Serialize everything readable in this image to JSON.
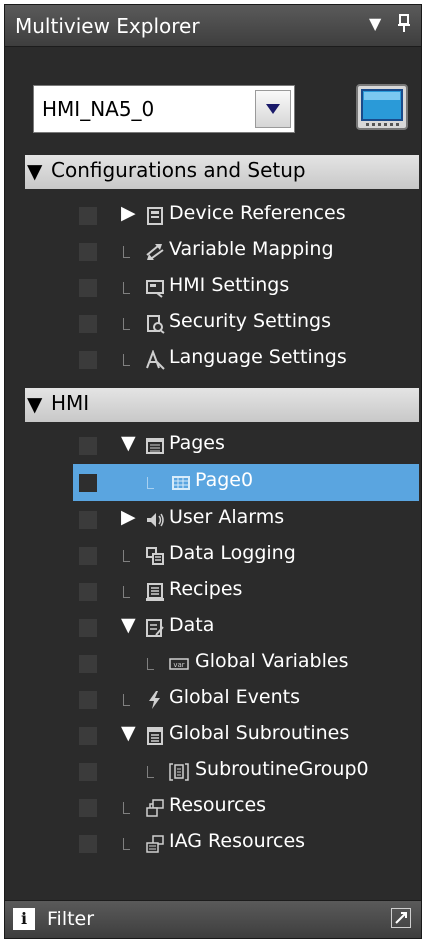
{
  "panel": {
    "title": "Multiview Explorer"
  },
  "device_combo": {
    "value": "HMI_NA5_0"
  },
  "tree": {
    "configurations": {
      "label": "Configurations and Setup",
      "items": [
        {
          "label": "Device References",
          "icon": "device-references-icon",
          "expanded": false
        },
        {
          "label": "Variable Mapping",
          "icon": "variable-mapping-icon"
        },
        {
          "label": "HMI Settings",
          "icon": "hmi-settings-icon"
        },
        {
          "label": "Security Settings",
          "icon": "security-settings-icon"
        },
        {
          "label": "Language Settings",
          "icon": "language-settings-icon"
        }
      ]
    },
    "hmi": {
      "label": "HMI",
      "items": [
        {
          "label": "Pages",
          "icon": "pages-icon",
          "expanded": true
        },
        {
          "label": "Page0",
          "icon": "page-icon",
          "selected": true
        },
        {
          "label": "User Alarms",
          "icon": "user-alarms-icon",
          "expanded": false
        },
        {
          "label": "Data Logging",
          "icon": "data-logging-icon"
        },
        {
          "label": "Recipes",
          "icon": "recipes-icon"
        },
        {
          "label": "Data",
          "icon": "data-icon",
          "expanded": true
        },
        {
          "label": "Global Variables",
          "icon": "global-variables-icon"
        },
        {
          "label": "Global Events",
          "icon": "global-events-icon"
        },
        {
          "label": "Global Subroutines",
          "icon": "global-subroutines-icon",
          "expanded": true
        },
        {
          "label": "SubroutineGroup0",
          "icon": "subroutine-group-icon"
        },
        {
          "label": "Resources",
          "icon": "resources-icon"
        },
        {
          "label": "IAG Resources",
          "icon": "iag-resources-icon"
        }
      ]
    }
  },
  "bottom": {
    "filter_label": "Filter"
  },
  "colors": {
    "panel_bg": "#2b2b2b",
    "selection": "#5aa5e0",
    "header_bg": "#d8d8d8",
    "text": "#ffffff"
  }
}
